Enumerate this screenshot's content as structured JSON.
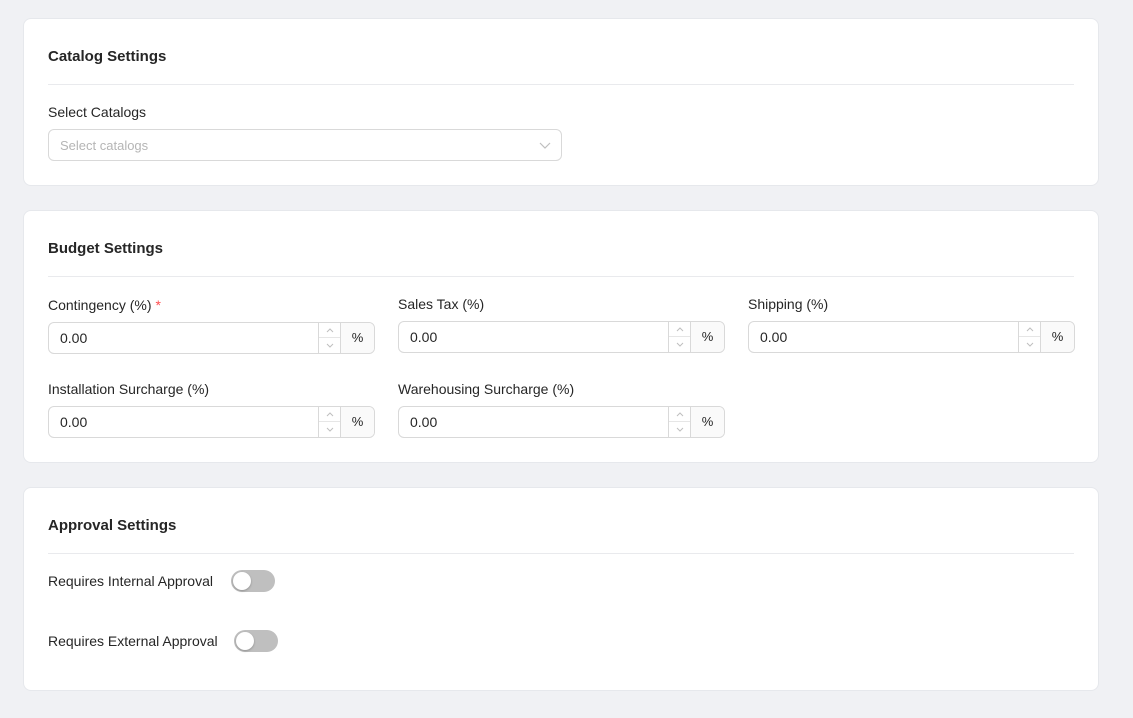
{
  "catalog": {
    "title": "Catalog Settings",
    "select_label": "Select Catalogs",
    "select_placeholder": "Select catalogs"
  },
  "budget": {
    "title": "Budget Settings",
    "fields": [
      {
        "label": "Contingency (%)",
        "value": "0.00",
        "addon": "%",
        "required": true
      },
      {
        "label": "Sales Tax (%)",
        "value": "0.00",
        "addon": "%"
      },
      {
        "label": "Shipping (%)",
        "value": "0.00",
        "addon": "%"
      },
      {
        "label": "Installation Surcharge (%)",
        "value": "0.00",
        "addon": "%"
      },
      {
        "label": "Warehousing Surcharge (%)",
        "value": "0.00",
        "addon": "%"
      }
    ],
    "required_mark": "*"
  },
  "approval": {
    "title": "Approval Settings",
    "internal_label": "Requires Internal Approval",
    "internal_enabled": false,
    "external_label": "Requires External Approval",
    "external_enabled": false
  },
  "colors": {
    "background": "#f0f1f4",
    "required": "#ff4d4f",
    "toggle_off": "#bfbfbf"
  }
}
